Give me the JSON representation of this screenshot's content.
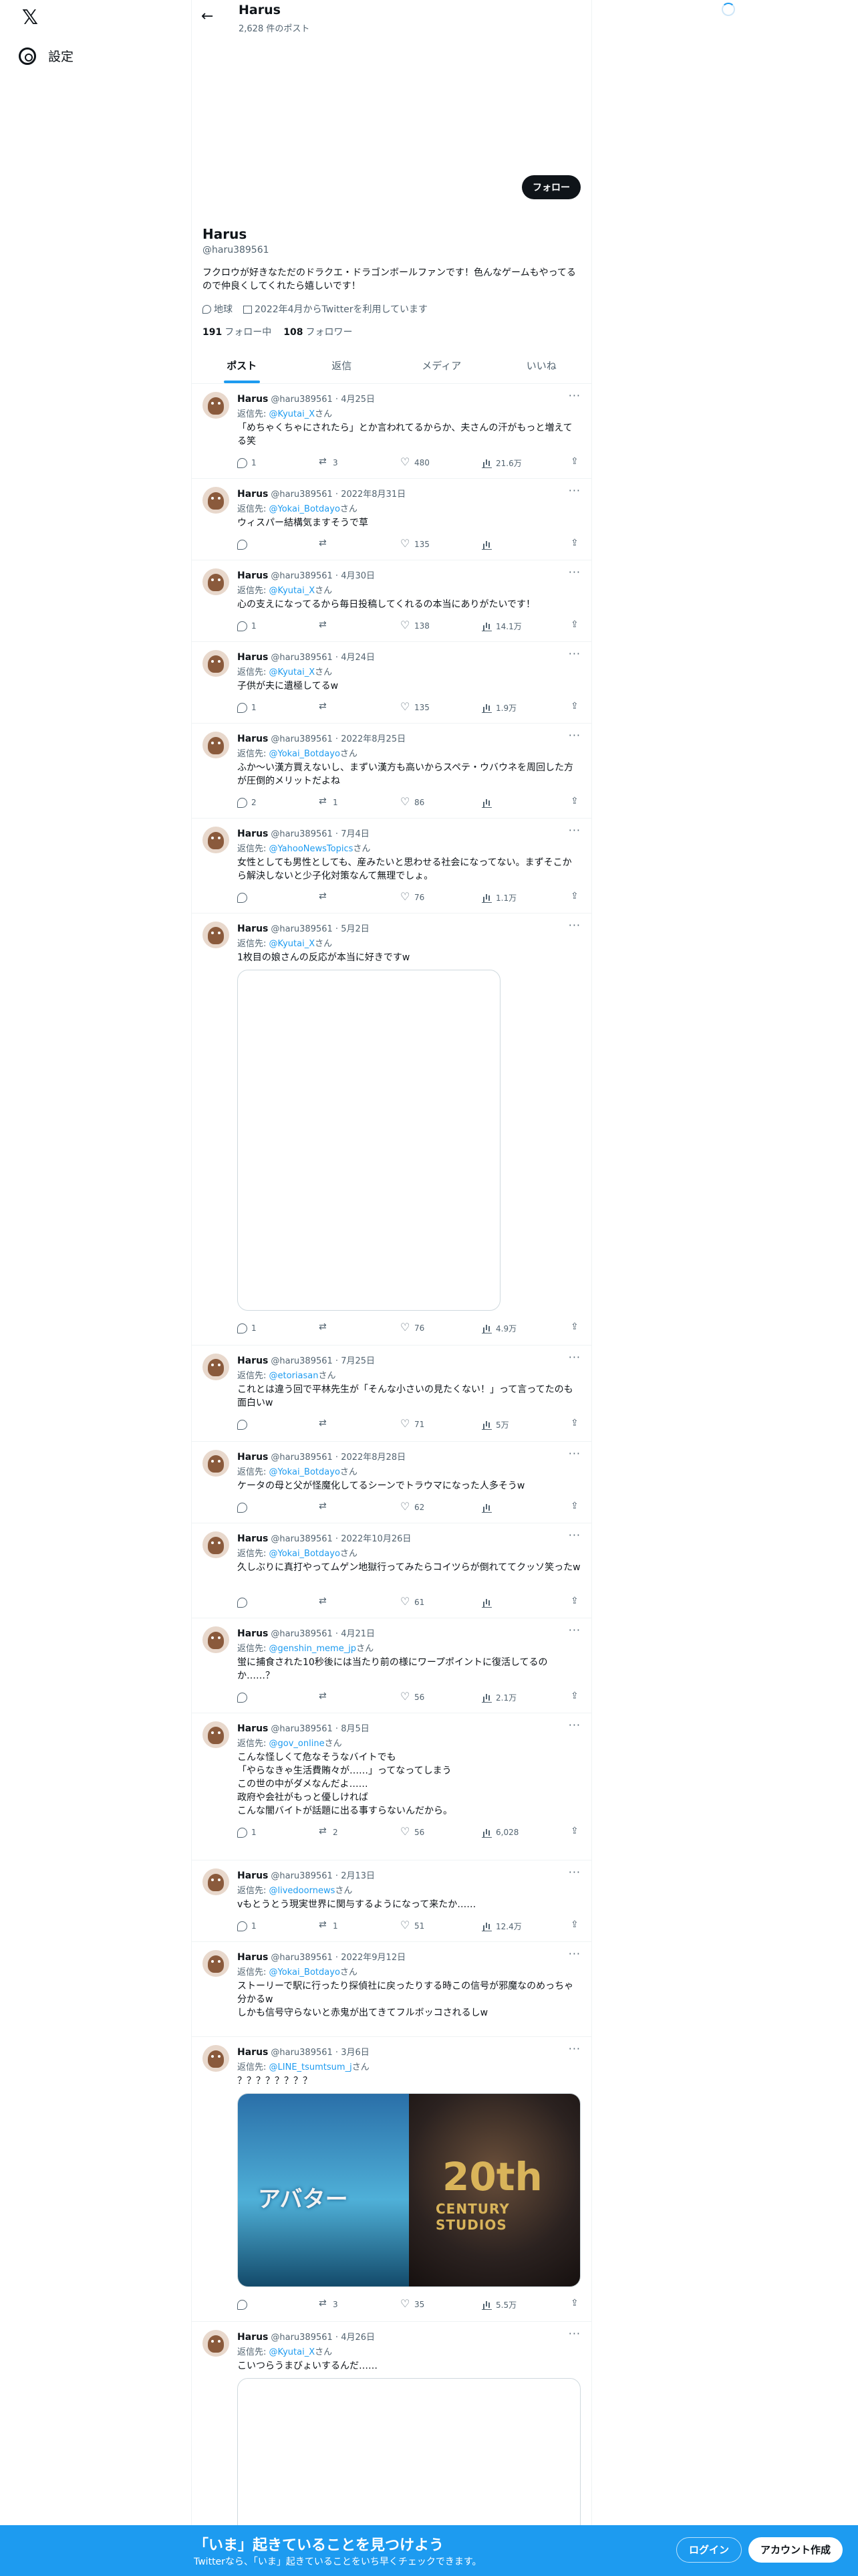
{
  "nav": {
    "logo": "𝕏",
    "settings_label": "設定"
  },
  "topbar": {
    "name": "Harus",
    "post_count": "2,628 件のポスト"
  },
  "profile": {
    "follow_button": "フォロー",
    "name": "Harus",
    "handle": "@haru389561",
    "bio": "フクロウが好きなただのドラクエ・ドラゴンボールファンです！色んなゲームもやってるので仲良くしてくれたら嬉しいです！",
    "location": "地球",
    "joined": "2022年4月からTwitterを利用しています",
    "following_count": "191",
    "following_label": "フォロー中",
    "followers_count": "108",
    "followers_label": "フォロワー"
  },
  "tabs": [
    {
      "label": "ポスト"
    },
    {
      "label": "返信"
    },
    {
      "label": "メディア"
    },
    {
      "label": "いいね"
    }
  ],
  "reply_prefix": "返信先: ",
  "reply_suffix": "さん",
  "tweets": [
    {
      "name": "Harus",
      "handle": "@haru389561",
      "date": "4月25日",
      "reply_to": "@Kyutai_X",
      "text": "「めちゃくちゃにされたら」とか言われてるからか、夫さんの汗がもっと増えてる笑",
      "replies": "1",
      "retweets": "3",
      "likes": "480",
      "views": "21.6万"
    },
    {
      "name": "Harus",
      "handle": "@haru389561",
      "date": "2022年8月31日",
      "reply_to": "@Yokai_Botdayo",
      "text": "ウィスパー結構気ますそうで草",
      "replies": "",
      "retweets": "",
      "likes": "135",
      "views": ""
    },
    {
      "name": "Harus",
      "handle": "@haru389561",
      "date": "4月30日",
      "reply_to": "@Kyutai_X",
      "text": "心の支えになってるから毎日投稿してくれるの本当にありがたいです！",
      "replies": "1",
      "retweets": "",
      "likes": "138",
      "views": "14.1万"
    },
    {
      "name": "Harus",
      "handle": "@haru389561",
      "date": "4月24日",
      "reply_to": "@Kyutai_X",
      "text": "子供が夫に遺極してるw",
      "replies": "1",
      "retweets": "",
      "likes": "135",
      "views": "1.9万"
    },
    {
      "name": "Harus",
      "handle": "@haru389561",
      "date": "2022年8月25日",
      "reply_to": "@Yokai_Botdayo",
      "text": "ふか〜い漢方買えないし、まずい漢方も高いからスペテ・ウバウネを周回した方が圧倒的メリットだよね",
      "replies": "2",
      "retweets": "1",
      "likes": "86",
      "views": ""
    },
    {
      "name": "Harus",
      "handle": "@haru389561",
      "date": "7月4日",
      "reply_to": "@YahooNewsTopics",
      "text": "女性としても男性としても、産みたいと思わせる社会になってない。まずそこから解決しないと少子化対策なんて無理でしょ。",
      "replies": "",
      "retweets": "",
      "likes": "76",
      "views": "1.1万"
    },
    {
      "name": "Harus",
      "handle": "@haru389561",
      "date": "5月2日",
      "reply_to": "@Kyutai_X",
      "text": "1枚目の娘さんの反応が本当に好きですw",
      "replies": "1",
      "retweets": "",
      "likes": "76",
      "views": "4.9万"
    },
    {
      "name": "Harus",
      "handle": "@haru389561",
      "date": "7月25日",
      "reply_to": "@etoriasan",
      "text": "これとは違う回で平林先生が「そんな小さいの見たくない！」って言ってたのも面白いw",
      "replies": "",
      "retweets": "",
      "likes": "71",
      "views": "5万"
    },
    {
      "name": "Harus",
      "handle": "@haru389561",
      "date": "2022年8月28日",
      "reply_to": "@Yokai_Botdayo",
      "text": "ケータの母と父が怪魔化してるシーンでトラウマになった人多そうw",
      "replies": "",
      "retweets": "",
      "likes": "62",
      "views": ""
    },
    {
      "name": "Harus",
      "handle": "@haru389561",
      "date": "2022年10月26日",
      "reply_to": "@Yokai_Botdayo",
      "text": "久しぶりに真打やってムゲン地獄行ってみたらコイツらが倒れててクッソ笑ったw",
      "replies": "",
      "retweets": "",
      "likes": "61",
      "views": ""
    },
    {
      "name": "Harus",
      "handle": "@haru389561",
      "date": "4月21日",
      "reply_to": "@genshin_meme_jp",
      "text": "蛍に捕食された10秒後には当たり前の様にワープポイントに復活してるの か……？",
      "replies": "",
      "retweets": "",
      "likes": "56",
      "views": "2.1万"
    },
    {
      "name": "Harus",
      "handle": "@haru389561",
      "date": "8月5日",
      "reply_to": "@gov_online",
      "text": "こんな怪しくて危なそうなバイトでも\n「やらなきゃ生活費賄々が……」ってなってしまう\nこの世の中がダメなんだよ……\n政府や会社がもっと優しければ\nこんな闇バイトが話題に出る事すらないんだから。",
      "replies": "1",
      "retweets": "2",
      "likes": "56",
      "views": "6,028"
    },
    {
      "name": "Harus",
      "handle": "@haru389561",
      "date": "2月13日",
      "reply_to": "@livedoornews",
      "text": "vもとうとう現実世界に関与するようになって来たか……",
      "replies": "1",
      "retweets": "1",
      "likes": "51",
      "views": "12.4万"
    },
    {
      "name": "Harus",
      "handle": "@haru389561",
      "date": "2022年9月12日",
      "reply_to": "@Yokai_Botdayo",
      "text": "ストーリーで駅に行ったり探偵社に戻ったりする時この信号が邪魔なのめっちゃ分かるw\nしかも信号守らないと赤鬼が出てきてフルボッコされるしw",
      "replies": "1",
      "retweets": "1",
      "likes": "51",
      "views": ""
    },
    {
      "name": "Harus",
      "handle": "@haru389561",
      "date": "3月6日",
      "reply_to": "@LINE_tsumtsum_j",
      "text": "？？？？？？？？",
      "replies": "",
      "retweets": "3",
      "likes": "35",
      "views": "5.5万",
      "media_left_text": "アバター",
      "media_right_title": "20th",
      "media_right_sub": "CENTURY STUDIOS"
    },
    {
      "name": "Harus",
      "handle": "@haru389561",
      "date": "4月26日",
      "reply_to": "@Kyutai_X",
      "text": "こいつらうまびょいするんだ……",
      "replies": "",
      "retweets": "",
      "likes": "",
      "views": ""
    }
  ],
  "bottom": {
    "title": "「いま」起きていることを見つけよう",
    "subtitle": "Twitterなら、「いま」起きていることをいち早くチェックできます。",
    "login": "ログイン",
    "signup": "アカウント作成"
  }
}
